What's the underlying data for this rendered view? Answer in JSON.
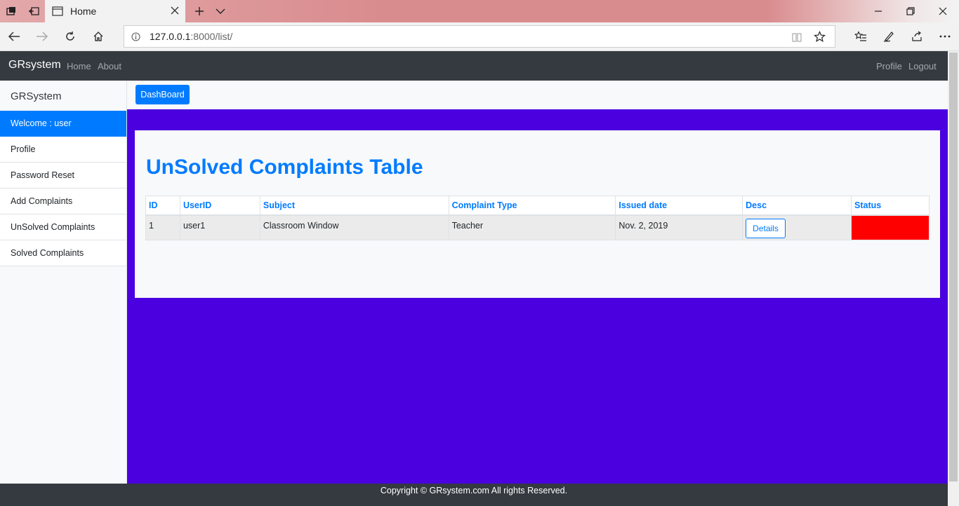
{
  "browser": {
    "tab_title": "Home",
    "url_host": "127.0.0.1",
    "url_rest": ":8000/list/"
  },
  "navbar": {
    "brand": "GRsystem",
    "links": [
      "Home",
      "About"
    ],
    "right_links": [
      "Profile",
      "Logout"
    ]
  },
  "sidebar": {
    "heading": "GRSystem",
    "items": [
      {
        "label": "Welcome : user"
      },
      {
        "label": "Profile"
      },
      {
        "label": "Password Reset"
      },
      {
        "label": "Add Complaints"
      },
      {
        "label": "UnSolved Complaints"
      },
      {
        "label": "Solved Complaints"
      }
    ]
  },
  "toolbar": {
    "dashboard_label": "DashBoard"
  },
  "main": {
    "title": "UnSolved Complaints Table",
    "table": {
      "headers": [
        "ID",
        "UserID",
        "Subject",
        "Complaint Type",
        "Issued date",
        "Desc",
        "Status"
      ],
      "rows": [
        {
          "id": "1",
          "user": "user1",
          "subject": "Classroom Window",
          "type": "Teacher",
          "date": "Nov. 2, 2019",
          "desc_button": "Details",
          "status_color": "#ff0000"
        }
      ]
    }
  },
  "footer": {
    "text": "Copyright © GRsystem.com All rights Reserved."
  },
  "colors": {
    "accent": "#007bff",
    "page_bg": "#4b00e0",
    "navbar": "#343a40",
    "status_unsolved": "#ff0000"
  }
}
